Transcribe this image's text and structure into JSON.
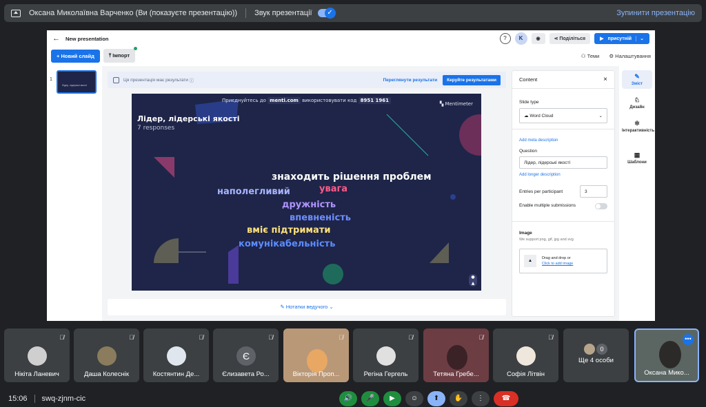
{
  "topbar": {
    "presenter_text": "Оксана Миколаївна Варченко (Ви (показуєте презентацію))",
    "sound_label": "Звук презентації",
    "stop_label": "Зупинити презентацію"
  },
  "mentimeter": {
    "doc_title": "New presentation",
    "avatar_letter": "K",
    "share_label": "Поділіться",
    "present_label": "присутній",
    "new_slide": "+ Новий слайд",
    "import": "Імпорт",
    "themes": "Теми",
    "settings": "Налаштування",
    "slide_number": "1",
    "results_notice": "Ця презентація має результати",
    "view_results": "Переглянути результати",
    "manage_results": "Керуйте результатами",
    "notes": "Нотатки ведучого",
    "slide": {
      "join_prefix": "Приєднуйтесь до",
      "join_site": "menti.com",
      "join_middle": "використовувати код",
      "join_code": "8951 1961",
      "brand": "Mentimeter",
      "question": "Лідер, лідерські якості",
      "responses": "7 responses",
      "thumb_text": "Лідер, лідерські якості",
      "words": [
        {
          "text": "знаходить рішення проблем",
          "color": "#ffffff"
        },
        {
          "text": "наполегливий",
          "color": "#a9b4ff"
        },
        {
          "text": "увага",
          "color": "#ff5a8a"
        },
        {
          "text": "дружність",
          "color": "#b094ff"
        },
        {
          "text": "впевненість",
          "color": "#6e8dff"
        },
        {
          "text": "вміє підтримати",
          "color": "#ffe27a"
        },
        {
          "text": "комунікабельність",
          "color": "#5b8cff"
        }
      ]
    },
    "panel": {
      "header": "Content",
      "slide_type_label": "Slide type",
      "slide_type_value": "Word Cloud",
      "meta_link": "Add meta description",
      "question_label": "Question",
      "question_value": "Лідер, лідерські якості",
      "longer_link": "Add longer description",
      "entries_label": "Entries per participant",
      "entries_value": "3",
      "multiple_label": "Enable multiple submissions",
      "image_label": "Image",
      "image_hint": "We support png, gif, jpg and svg",
      "drag_text": "Drag and drop or",
      "click_text": "Click to add image"
    },
    "rail": [
      "Зміст",
      "Дизайн",
      "Інтерактивність",
      "Шаблони"
    ]
  },
  "participants": [
    {
      "name": "Нікіта Ланевич"
    },
    {
      "name": "Даша Колеснік"
    },
    {
      "name": "Костянтин Де..."
    },
    {
      "name": "Єлизавета Ро...",
      "initial": "Є"
    },
    {
      "name": "Вікторія Проп..."
    },
    {
      "name": "Регіна Гергель"
    },
    {
      "name": "Тетяна Гребе..."
    },
    {
      "name": "Софія Літвін"
    },
    {
      "name": "Ще 4 особи",
      "count": "0"
    },
    {
      "name": "Оксана Мико..."
    }
  ],
  "bottombar": {
    "time": "15:06",
    "meeting_code": "swq-zjnm-cic"
  }
}
